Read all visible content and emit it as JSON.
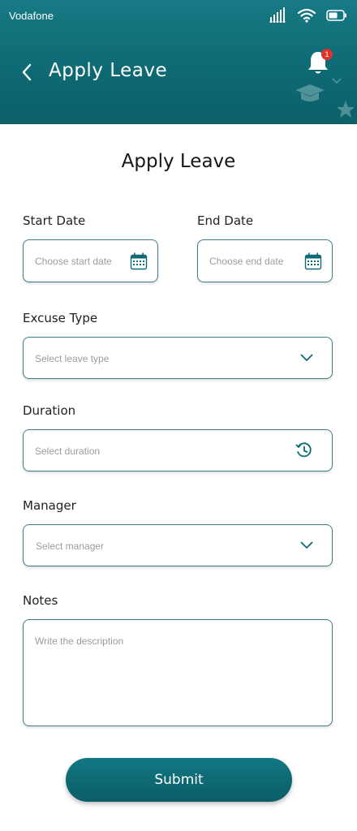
{
  "status_bar": {
    "carrier": "Vodafone",
    "icons": [
      "signal-icon",
      "wifi-icon",
      "battery-icon"
    ]
  },
  "header": {
    "title": "Apply Leave",
    "notification_count": "1",
    "back_icon": "chevron-left-icon",
    "bell_icon": "bell-icon"
  },
  "form": {
    "title": "Apply Leave",
    "start_date": {
      "label": "Start Date",
      "placeholder": "Choose start date",
      "icon": "calendar-icon"
    },
    "end_date": {
      "label": "End Date",
      "placeholder": "Choose end date",
      "icon": "calendar-icon"
    },
    "excuse_type": {
      "label": "Excuse Type",
      "placeholder": "Select leave type",
      "icon": "chevron-down-icon"
    },
    "duration": {
      "label": "Duration",
      "placeholder": "Select duration",
      "icon": "history-icon"
    },
    "manager": {
      "label": "Manager",
      "placeholder": "Select manager",
      "icon": "chevron-down-icon"
    },
    "notes": {
      "label": "Notes",
      "placeholder": "Write the description"
    },
    "submit_label": "Submit"
  },
  "colors": {
    "primary": "#0e6a74",
    "field_border": "#3c7e86",
    "badge": "#e0322b",
    "placeholder": "#9c9c9c"
  }
}
